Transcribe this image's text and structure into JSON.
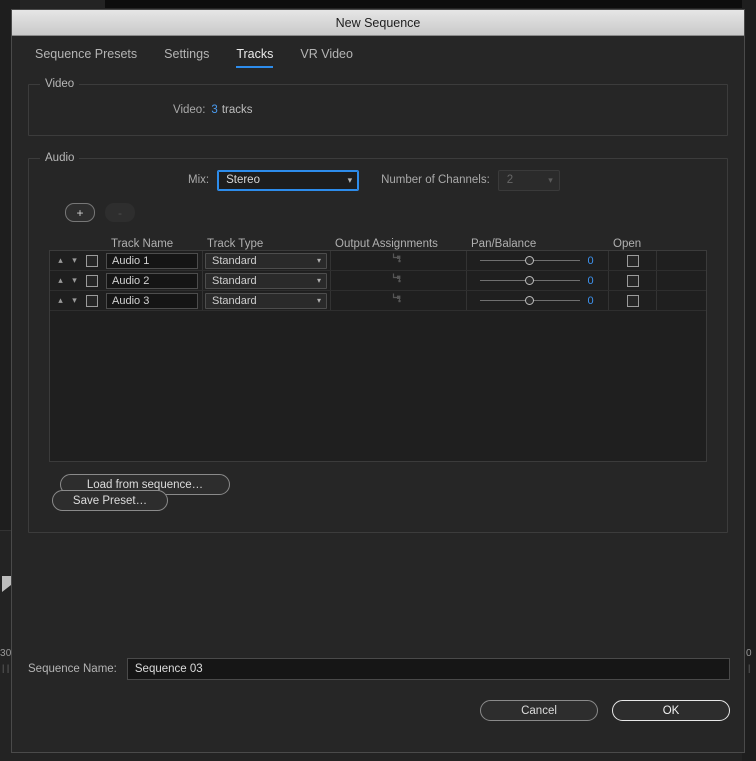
{
  "background": {
    "timecode_left": "30",
    "timecode_ticks_left": "| |",
    "timecode_right": "0",
    "timecode_ticks_right": "|"
  },
  "window": {
    "title": "New Sequence"
  },
  "tabs": [
    {
      "label": "Sequence Presets",
      "active": false
    },
    {
      "label": "Settings",
      "active": false
    },
    {
      "label": "Tracks",
      "active": true
    },
    {
      "label": "VR Video",
      "active": false
    }
  ],
  "video_group": {
    "legend": "Video",
    "field_label": "Video:",
    "track_count": "3",
    "track_unit": "tracks"
  },
  "audio_group": {
    "legend": "Audio",
    "mix_label": "Mix:",
    "mix_value": "Stereo",
    "channels_label": "Number of Channels:",
    "channels_value": "2",
    "add_button": "+",
    "remove_button": "-",
    "load_from_sequence": "Load from sequence…"
  },
  "track_table": {
    "columns": [
      "",
      "Track Name",
      "Track Type",
      "Output Assignments",
      "Pan/Balance",
      "Open",
      ""
    ],
    "rows": [
      {
        "name": "Audio 1",
        "type": "Standard",
        "pan": "0",
        "enabled": false,
        "open": false
      },
      {
        "name": "Audio 2",
        "type": "Standard",
        "pan": "0",
        "enabled": false,
        "open": false
      },
      {
        "name": "Audio 3",
        "type": "Standard",
        "pan": "0",
        "enabled": false,
        "open": false
      }
    ]
  },
  "save_preset": "Save Preset…",
  "sequence_name": {
    "label": "Sequence Name:",
    "value": "Sequence 03"
  },
  "footer": {
    "cancel": "Cancel",
    "ok": "OK"
  },
  "colors": {
    "accent_blue": "#2d8ceb",
    "value_blue": "#4a9bf0",
    "dialog_bg": "#262626",
    "titlebar": "#d9d9d9"
  }
}
